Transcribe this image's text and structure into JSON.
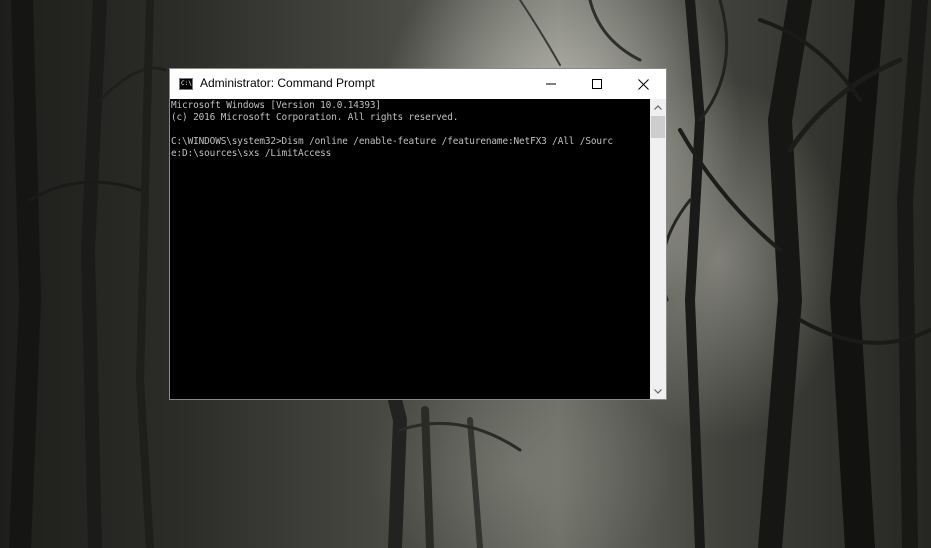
{
  "window": {
    "title": "Administrator: Command Prompt",
    "app_icon_text": "C:\\."
  },
  "console": {
    "lines": [
      "Microsoft Windows [Version 10.0.14393]",
      "(c) 2016 Microsoft Corporation. All rights reserved.",
      "",
      "C:\\WINDOWS\\system32>Dism /online /enable-feature /featurename:NetFX3 /All /Sourc",
      "e:D:\\sources\\sxs /LimitAccess"
    ],
    "text_color": "#c0c0c0",
    "background_color": "#000000"
  },
  "icons": {
    "app": "cmd-icon",
    "minimize": "minimize-icon",
    "maximize": "maximize-icon",
    "close": "close-icon",
    "scroll_up": "chevron-up-icon",
    "scroll_down": "chevron-down-icon"
  }
}
